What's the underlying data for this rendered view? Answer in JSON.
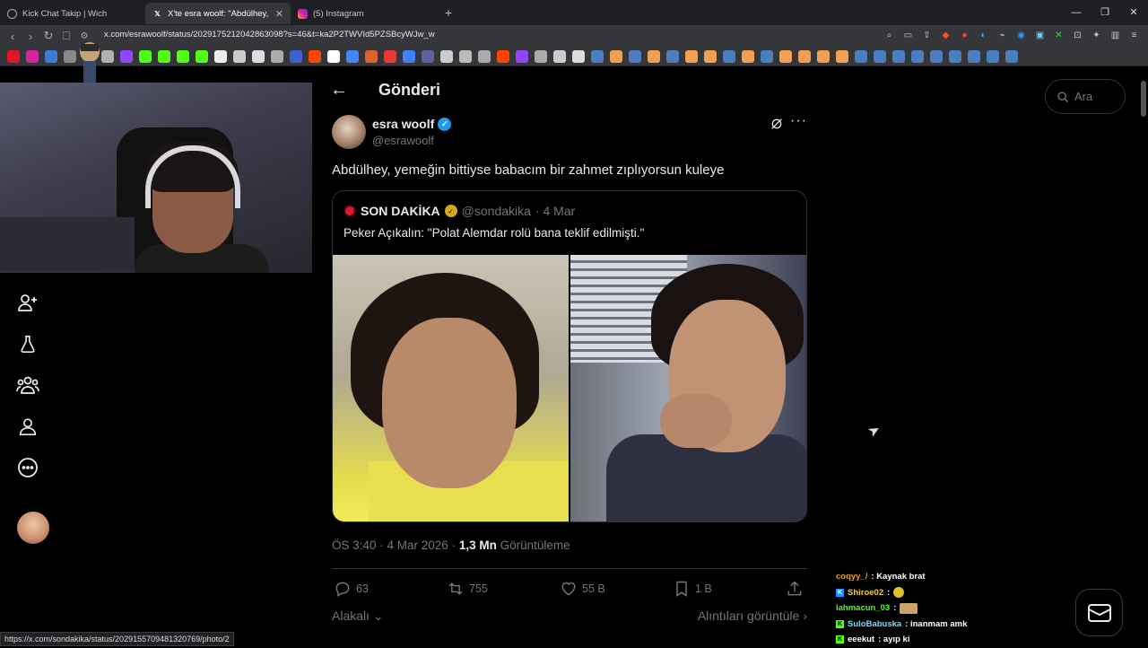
{
  "browser": {
    "tabs": [
      {
        "title": "Kick Chat Takip | Wich",
        "active": false
      },
      {
        "title": "X'te esra woolf: \"Abdülhey, yeme",
        "active": true
      },
      {
        "title": "(5) Instagram",
        "active": false
      }
    ],
    "url": "x.com/esrawoolf/status/2029175212042863098?s=46&t=ka2P2TWVId5PZSBcyWJw_w",
    "status_url": "https://x.com/sondakika/status/2029155709481320769/photo/2"
  },
  "page": {
    "header_title": "Gönderi",
    "search_placeholder": "Ara"
  },
  "tweet": {
    "author_name": "esra woolf",
    "author_handle": "@esrawoolf",
    "text": "Abdülhey, yemeğin bittiyse babacım bir zahmet zıplıyorsun kuleye",
    "quote": {
      "name": "SON DAKİKA",
      "handle": "@sondakika",
      "date": "· 4 Mar",
      "text": "Peker Açıkalın: \"Polat Alemdar rolü bana teklif edilmişti.\""
    },
    "time": "ÖS 3:40 · 4 Mar 2026 ·",
    "views": "1,3 Mn",
    "views_label": "Görüntüleme",
    "replies": "63",
    "reposts": "755",
    "likes": "55 B",
    "bookmarks": "1 B",
    "sort_label": "Alakalı",
    "quotes_link": "Alıntıları görüntüle"
  },
  "chat": [
    {
      "user": "coqyy_/",
      "msg": ": Kaynak brat",
      "badge": "",
      "color": "#f0a020"
    },
    {
      "user": "Shiroe02",
      "msg": ":",
      "badge": "K",
      "color": "#f0d040",
      "emote": "small"
    },
    {
      "user": "lahmacun_03",
      "msg": ":",
      "badge": "",
      "color": "#53fc18",
      "emote": "wide"
    },
    {
      "user": "SuloBabuska",
      "msg": ": inanmam amk",
      "badge": "K",
      "color": "#7ad8ff"
    },
    {
      "user": "eeekut",
      "msg": ": ayıp ki",
      "badge": "K",
      "color": "#ffffff"
    }
  ]
}
